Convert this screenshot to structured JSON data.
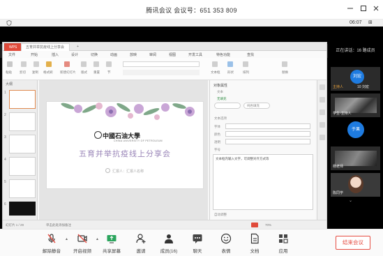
{
  "window": {
    "title": "腾讯会议 会议号：651 353 809",
    "timer": "06:07"
  },
  "share_bar": {
    "status": "正在讲话：16 路成员"
  },
  "ppt": {
    "tabs": [
      "WPS",
      "五育并举抗疫线上分享会",
      "+"
    ],
    "menus": [
      "文件",
      "开始",
      "插入",
      "设计",
      "切换",
      "动画",
      "放映",
      "审阅",
      "视图",
      "开发工具",
      "特色功能",
      "查找"
    ],
    "ribbon_labels": [
      "粘贴",
      "剪切",
      "复制",
      "格式刷",
      "新建幻灯片",
      "版式",
      "重置",
      "节",
      "文本框",
      "形状",
      "排列",
      "替换"
    ],
    "thumbs_title": "大纲",
    "slide_numbers": [
      "1",
      "2",
      "3",
      "4",
      "5",
      "6"
    ],
    "slide": {
      "university": "中國石油大學",
      "university_sub": "CHINA UNIVERSITY OF PETROLEUM",
      "headline": "五育并举抗疫线上分享会",
      "author": "汇报人：汇报人名称"
    },
    "pane": {
      "title": "对象属性",
      "subtitle": "文本",
      "tab_a": "无填充",
      "tab_b": "纯色填充",
      "section": "文本选项",
      "field_1": "字体",
      "field_2": "颜色",
      "field_3": "透明",
      "field_4": "字号",
      "note": "文本框内输入文字，可调整对齐方式等",
      "footer": "自动调整"
    },
    "status": {
      "left": "幻灯片 1 / 29",
      "mid": "单击此处添加备注",
      "zoom": "70%"
    }
  },
  "participants": {
    "count": "成员（16）",
    "tiles": [
      {
        "avatar": "刘宏",
        "name": "主持人",
        "badge": "10 刘宏"
      },
      {
        "name": "学生-主持人"
      },
      {
        "avatar": "于果",
        "name": "于果"
      },
      {
        "name": "杨老师"
      },
      {
        "name": "陈同学"
      }
    ]
  },
  "toolbar": {
    "items": [
      {
        "icon": "microphone-muted-icon",
        "label": "解除静音"
      },
      {
        "icon": "camera-off-icon",
        "label": "开启视频"
      },
      {
        "icon": "share-screen-icon",
        "label": "共享屏幕"
      },
      {
        "icon": "invite-icon",
        "label": "邀请"
      },
      {
        "icon": "members-icon",
        "label": "成员(16)"
      },
      {
        "icon": "chat-icon",
        "label": "聊天"
      },
      {
        "icon": "reaction-icon",
        "label": "表情"
      },
      {
        "icon": "document-icon",
        "label": "文档"
      },
      {
        "icon": "apps-icon",
        "label": "应用"
      }
    ],
    "end_button": "结束会议"
  },
  "colors": {
    "accent": "#1e7be0",
    "danger": "#e54d42",
    "headline": "#9a86b8",
    "ppt_tab_accent": "#e04a3a"
  }
}
